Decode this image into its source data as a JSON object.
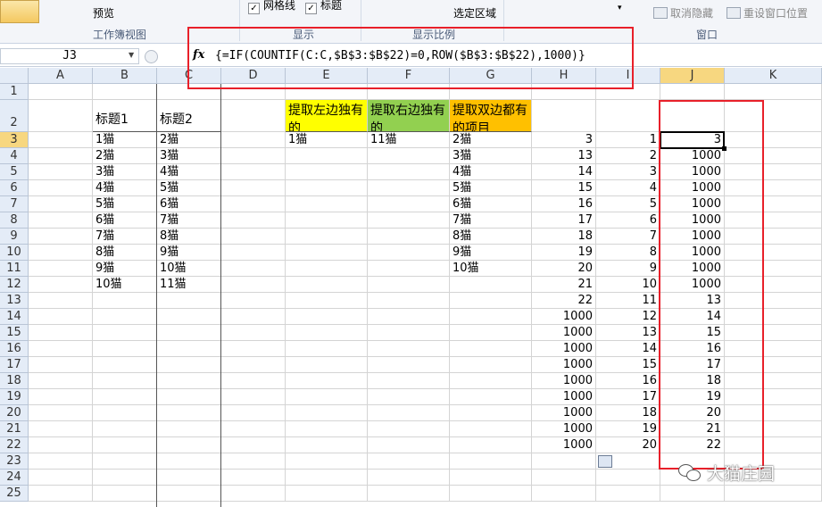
{
  "ribbon": {
    "preview_label": "预览",
    "gridlines_label": "网格线",
    "titles_label": "标题",
    "selection_label": "选定区域",
    "unhide_label": "取消隐藏",
    "reset_window_label": "重设窗口位置",
    "group_workbook_views": "工作簿视图",
    "group_show": "显示",
    "group_zoom": "显示比例",
    "group_window": "窗口",
    "gridlines_checked": true,
    "titles_checked": true
  },
  "formula_bar": {
    "name_box": "J3",
    "fx_label": "fx",
    "formula": "{=IF(COUNTIF(C:C,$B$3:$B$22)=0,ROW($B$3:$B$22),1000)}"
  },
  "columns": [
    "A",
    "B",
    "C",
    "D",
    "E",
    "F",
    "G",
    "H",
    "I",
    "J",
    "K"
  ],
  "rows": [
    "1",
    "2",
    "3",
    "4",
    "5",
    "6",
    "7",
    "8",
    "9",
    "10",
    "11",
    "12",
    "13",
    "14",
    "15",
    "16",
    "17",
    "18",
    "19",
    "20",
    "21",
    "22",
    "23",
    "24",
    "25"
  ],
  "headers": {
    "B2": "标题1",
    "C2": "标题2",
    "E2": "提取左边独有的",
    "F2": "提取右边独有的",
    "G2": "提取双边都有的项目"
  },
  "colB": [
    "1猫",
    "2猫",
    "3猫",
    "4猫",
    "5猫",
    "6猫",
    "7猫",
    "8猫",
    "9猫",
    "10猫"
  ],
  "colC": [
    "2猫",
    "3猫",
    "4猫",
    "5猫",
    "6猫",
    "7猫",
    "8猫",
    "9猫",
    "10猫",
    "11猫"
  ],
  "colE": [
    "1猫"
  ],
  "colF": [
    "11猫"
  ],
  "colG": [
    "2猫",
    "3猫",
    "4猫",
    "5猫",
    "6猫",
    "7猫",
    "8猫",
    "9猫",
    "10猫"
  ],
  "colH": [
    "3",
    "13",
    "14",
    "15",
    "16",
    "17",
    "18",
    "19",
    "20",
    "21",
    "22",
    "1000",
    "1000",
    "1000",
    "1000",
    "1000",
    "1000",
    "1000",
    "1000",
    "1000"
  ],
  "colI": [
    "1",
    "2",
    "3",
    "4",
    "5",
    "6",
    "7",
    "8",
    "9",
    "10",
    "11",
    "12",
    "13",
    "14",
    "15",
    "16",
    "17",
    "18",
    "19",
    "20"
  ],
  "colJ": [
    "3",
    "1000",
    "1000",
    "1000",
    "1000",
    "1000",
    "1000",
    "1000",
    "1000",
    "1000",
    "13",
    "14",
    "15",
    "16",
    "17",
    "18",
    "19",
    "20",
    "21",
    "22"
  ],
  "colors": {
    "yellow": "#ffff00",
    "green": "#92d050",
    "orange": "#ffc000",
    "highlight_red": "#e8202a"
  },
  "watermark": "大猫庄园"
}
